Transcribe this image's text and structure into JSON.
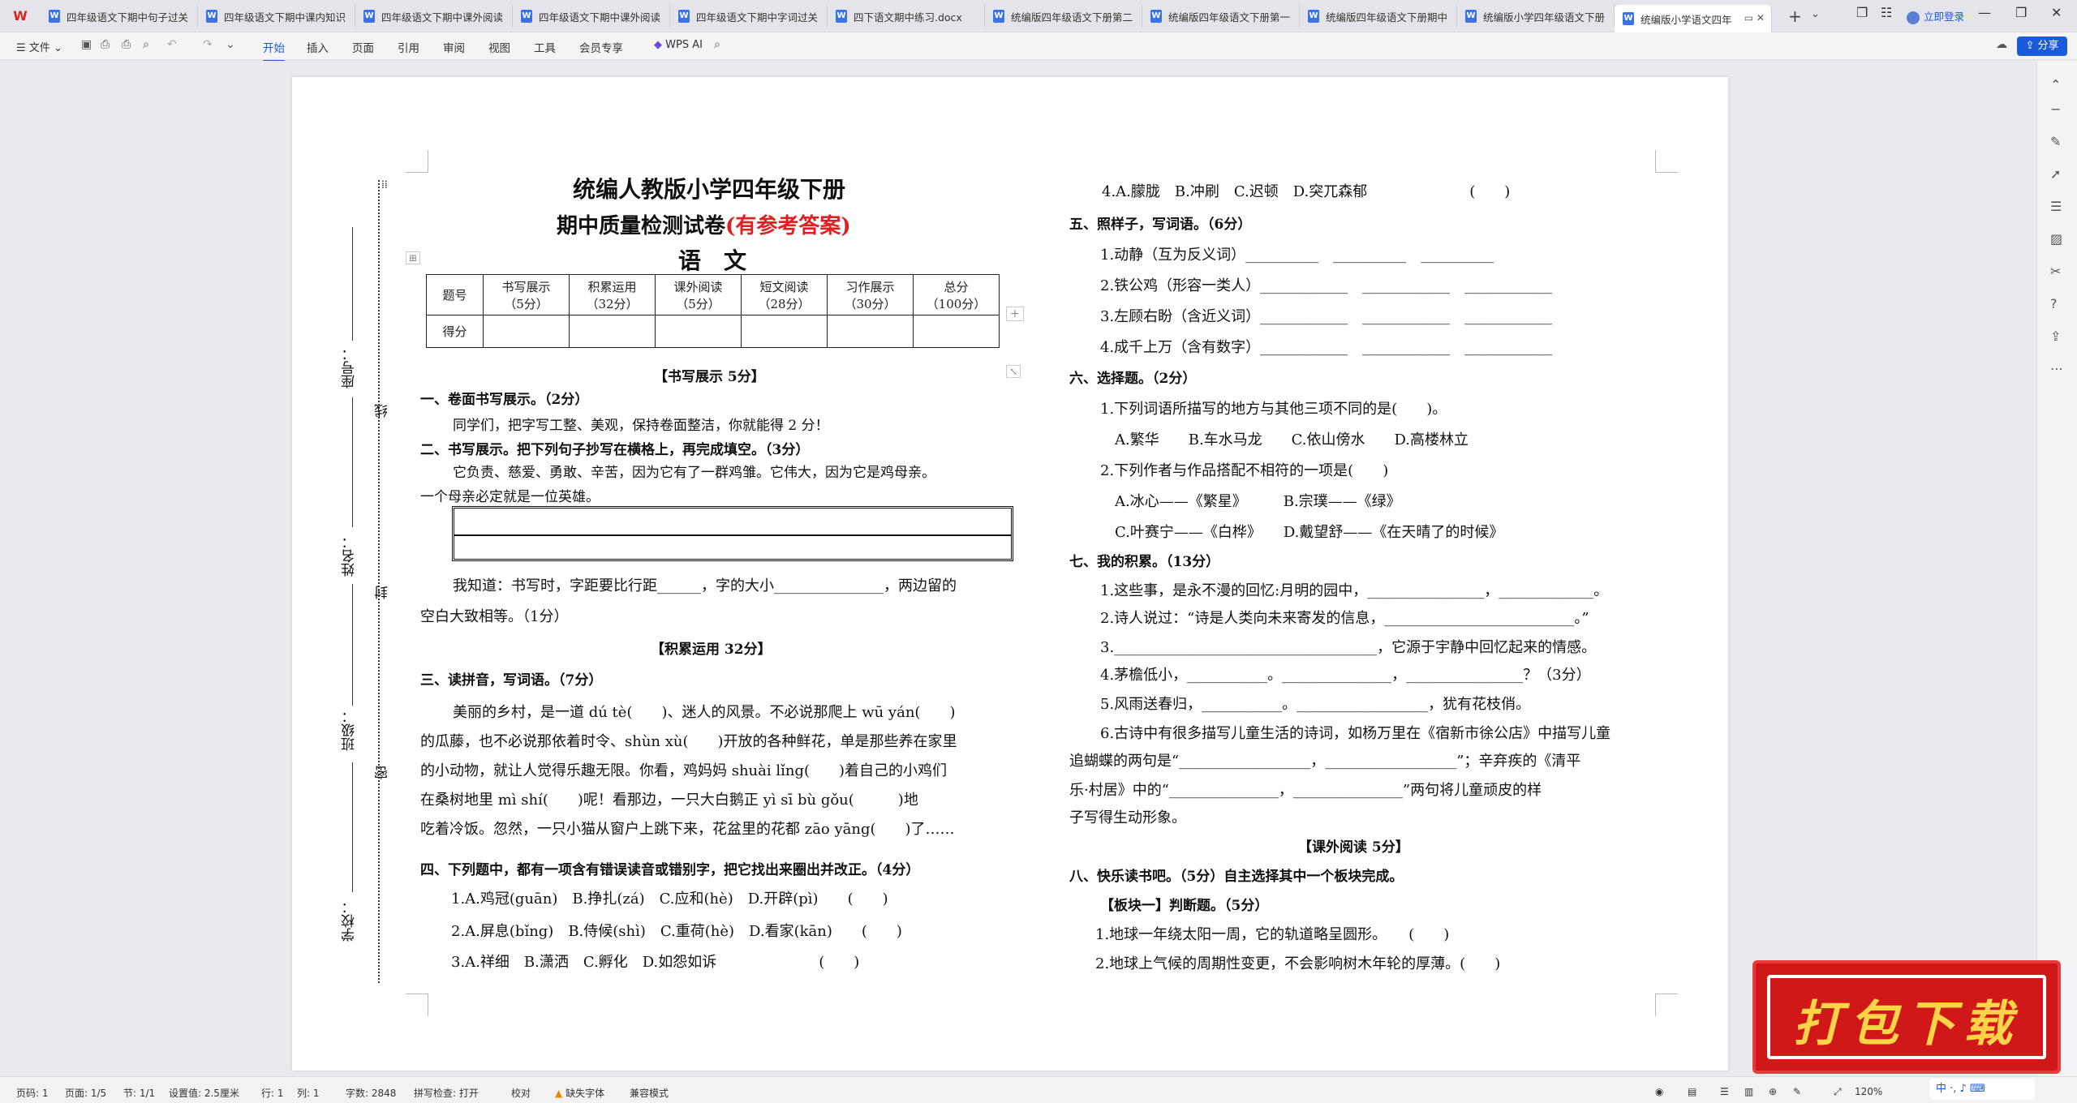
{
  "tabbar": {
    "tabs": [
      {
        "label": "四年级语文下期中句子过关"
      },
      {
        "label": "四年级语文下期中课内知识"
      },
      {
        "label": "四年级语文下期中课外阅读"
      },
      {
        "label": "四年级语文下期中课外阅读"
      },
      {
        "label": "四年级语文下期中字词过关"
      },
      {
        "label": "四下语文期中练习.docx"
      },
      {
        "label": "统编版四年级语文下册第二"
      },
      {
        "label": "统编版四年级语文下册第一"
      },
      {
        "label": "统编版四年级语文下册期中"
      },
      {
        "label": "统编版小学四年级语文下册"
      },
      {
        "label": "统编版小学语文四年"
      }
    ],
    "login_label": "立即登录"
  },
  "ribbon": {
    "file_label": "文件",
    "tabs": [
      "开始",
      "插入",
      "页面",
      "引用",
      "审阅",
      "视图",
      "工具",
      "会员专享"
    ],
    "ai_label": "WPS AI",
    "share_label": "分享"
  },
  "doc": {
    "title1": "统编人教版小学四年级下册",
    "title2": "期中质量检测试卷",
    "title2_red": "(有参考答案)",
    "subject": "语　文",
    "side": {
      "seat": "座号：",
      "name": "姓名：",
      "class": "班级：",
      "school": "学校：",
      "xian": "线",
      "feng": "封",
      "mi": "密"
    },
    "score_table": {
      "headers": [
        [
          "题号",
          ""
        ],
        [
          "书写展示",
          "（5分）"
        ],
        [
          "积累运用",
          "（32分）"
        ],
        [
          "课外阅读",
          "（5分）"
        ],
        [
          "短文阅读",
          "（28分）"
        ],
        [
          "习作展示",
          "（30分）"
        ],
        [
          "总分",
          "（100分）"
        ]
      ],
      "row2": "得分"
    },
    "left": {
      "sec_write": "【书写展示 5分】",
      "q1": "一、卷面书写展示。（2分）",
      "q1_text": "同学们，把字写工整、美观，保持卷面整洁，你就能得 2 分！",
      "q2": "二、书写展示。把下列句子抄写在横格上，再完成填空。（3分）",
      "q2_text1": "它负责、慈爱、勇敢、辛苦，因为它有了一群鸡雏。它伟大，因为它是鸡母亲。",
      "q2_text2": "一个母亲必定就是一位英雄。",
      "q2_fill1": "我知道：书写时，字距要比行距______，字的大小_______________，两边留的",
      "q2_fill2": "空白大致相等。（1分）",
      "sec_accum": "【积累运用 32分】",
      "q3": "三、读拼音，写词语。（7分）",
      "p1": "美丽的乡村，是一道 dú tè(　　)、迷人的风景。不必说那爬上 wū yán(　　)",
      "p2": "的瓜藤，也不必说那依着时令、shùn xù(　　)开放的各种鲜花，单是那些养在家里",
      "p3": "的小动物，就让人觉得乐趣无限。你看，鸡妈妈 shuài lǐng(　　)着自己的小鸡们",
      "p4": "在桑树地里 mì shí(　　)呢！看那边，一只大白鹅正 yì sī bù gǒu(　　　)地",
      "p5": "吃着冷饭。忽然，一只小猫从窗户上跳下来，花盆里的花都 zāo yāng(　　)了……",
      "q4": "四、下列题中，都有一项含有错误读音或错别字，把它找出来圈出并改正。（4分）",
      "q4_1": "1.A.鸡冠(guān)　B.挣扎(zá)　C.应和(hè)　D.开辟(pì)　　(　　)",
      "q4_2": "2.A.屏息(bǐng)　B.侍候(shì)　C.重荷(hè)　D.看家(kān)　　(　　)",
      "q4_3": "3.A.祥细　B.潇洒　C.孵化　D.如怨如诉　　　　　　　(　　)"
    },
    "right": {
      "q4_4": "4.A.朦胧　B.冲刷　C.迟顿　D.突兀森郁　　　　　　　(　　)",
      "q5": "五、照样子，写词语。（6分）",
      "q5_1": "1.动静（互为反义词）__________　__________　__________",
      "q5_2": "2.铁公鸡（形容一类人）____________　____________　____________",
      "q5_3": "3.左顾右盼（含近义词）____________　____________　____________",
      "q5_4": "4.成千上万（含有数字）____________　____________　____________",
      "q6": "六、选择题。（2分）",
      "q6_1": "1.下列词语所描写的地方与其他三项不同的是(　　)。",
      "q6_1o": "A.繁华　　B.车水马龙　　C.依山傍水　　D.高楼林立",
      "q6_2": "2.下列作者与作品搭配不相符的一项是(　　)",
      "q6_2a": "A.冰心——《繁星》　　　B.宗璞——《绿》",
      "q6_2b": "C.叶赛宁——《白桦》　　D.戴望舒——《在天晴了的时候》",
      "q7": "七、我的积累。（13分）",
      "q7_1": "1.这些事，是永不漫的回忆:月明的园中，________________，_____________。",
      "q7_2": "2.诗人说过：“诗是人类向未来寄发的信息，__________________________。”",
      "q7_3": "3.____________________________________，它源于宇静中回忆起来的情感。",
      "q7_4": "4.茅檐低小，___________。_______________，________________？（3分）",
      "q7_5": "5.风雨送春归，___________。__________________，犹有花枝俏。",
      "q7_6a": "6.古诗中有很多描写儿童生活的诗词，如杨万里在《宿新市徐公店》中描写儿童",
      "q7_6b": "追蝴蝶的两句是“__________________，__________________”；辛弃疾的《清平",
      "q7_6c": "乐·村居》中的“_______________，_______________”两句将儿童顽皮的样",
      "q7_6d": "子写得生动形象。",
      "sec_read": "【课外阅读 5分】",
      "q8": "八、快乐读书吧。（5分）自主选择其中一个板块完成。",
      "q8_block": "【板块一】判断题。（5分）",
      "q8_1": "1.地球一年绕太阳一周，它的轨道略呈圆形。　　(　　)",
      "q8_2": "2.地球上气候的周期性变更，不会影响树木年轮的厚薄。(　　)"
    }
  },
  "status": {
    "page": "页码: 1",
    "pages": "页面: 1/5",
    "section": "节: 1/1",
    "setting": "设置值: 2.5厘米",
    "row": "行: 1",
    "col": "列: 1",
    "words": "字数: 2848",
    "spell": "拼写检查: 打开",
    "proof": "校对",
    "font_missing": "缺失字体",
    "compat": "兼容模式",
    "zoom": "120%"
  },
  "promo": {
    "text": "打包下载"
  },
  "ime": {
    "text": "中 ·, ♪ ⌨"
  }
}
